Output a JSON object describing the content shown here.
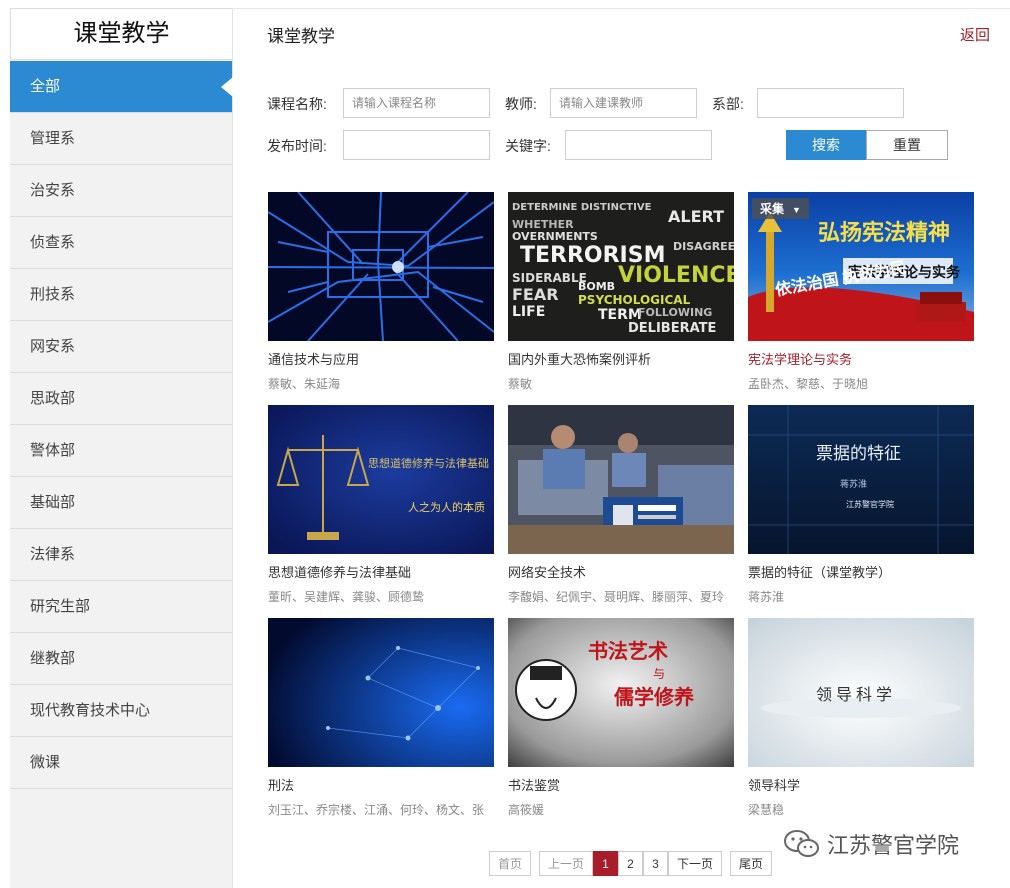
{
  "sidebar": {
    "title": "课堂教学",
    "items": [
      {
        "label": "全部",
        "active": true
      },
      {
        "label": "管理系"
      },
      {
        "label": "治安系"
      },
      {
        "label": "侦查系"
      },
      {
        "label": "刑技系"
      },
      {
        "label": "网安系"
      },
      {
        "label": "思政部"
      },
      {
        "label": "警体部"
      },
      {
        "label": "基础部"
      },
      {
        "label": "法律系"
      },
      {
        "label": "研究生部"
      },
      {
        "label": "继教部"
      },
      {
        "label": "现代教育技术中心"
      },
      {
        "label": "微课"
      }
    ]
  },
  "header": {
    "title": "课堂教学",
    "back": "返回"
  },
  "filters": {
    "course_label": "课程名称:",
    "course_placeholder": "请输入课程名称",
    "teacher_label": "教师:",
    "teacher_placeholder": "请输入建课教师",
    "dept_label": "系部:",
    "date_label": "发布时间:",
    "keyword_label": "关键字:",
    "search": "搜索",
    "reset": "重置"
  },
  "courses": [
    {
      "title": "通信技术与应用",
      "teachers": "蔡敏、朱延海",
      "thumb": "circuit"
    },
    {
      "title": "国内外重大恐怖案例评析",
      "teachers": "蔡敏",
      "thumb": "terror"
    },
    {
      "title": "宪法学理论与实务",
      "teachers": "孟卧杰、黎慈、于晓旭",
      "thumb": "constitution",
      "tag": "采集",
      "thumb_text1": "弘扬宪法精神",
      "thumb_text2": "宪法学理论与实务",
      "thumb_text3": "依法治国 执政为民"
    },
    {
      "title": "思想道德修养与法律基础",
      "teachers": "董昕、吴建辉、龚骏、顾德鸷",
      "thumb": "scales",
      "thumb_text1": "思想道德修养与法律基础",
      "thumb_text2": "人之为人的本质"
    },
    {
      "title": "网络安全技术",
      "teachers": "李馥娟、纪佩宇、聂明辉、滕丽萍、夏玲",
      "thumb": "photo"
    },
    {
      "title": "票据的特征（课堂教学）",
      "teachers": "蒋苏淮",
      "thumb": "bill",
      "thumb_text1": "票据的特征",
      "thumb_text2": "蒋苏淮",
      "thumb_text3": "江苏警官学院"
    },
    {
      "title": "刑法",
      "teachers": "刘玉江、乔宗楼、江涌、何玲、杨文、张",
      "thumb": "network"
    },
    {
      "title": "书法鉴赏",
      "teachers": "高筱媛",
      "thumb": "calligraphy",
      "thumb_text1": "书法艺术",
      "thumb_text2": "与",
      "thumb_text3": "儒学修养"
    },
    {
      "title": "领导科学",
      "teachers": "梁慧稳",
      "thumb": "leader",
      "thumb_text1": "领导科学"
    }
  ],
  "pager": {
    "first": "首页",
    "prev": "上一页",
    "pages": [
      "1",
      "2",
      "3"
    ],
    "current": "1",
    "next": "下一页",
    "last": "尾页"
  },
  "watermark": "江苏警官学院",
  "colors": {
    "accent": "#2c8ad3",
    "highlight": "#a71d2a"
  }
}
